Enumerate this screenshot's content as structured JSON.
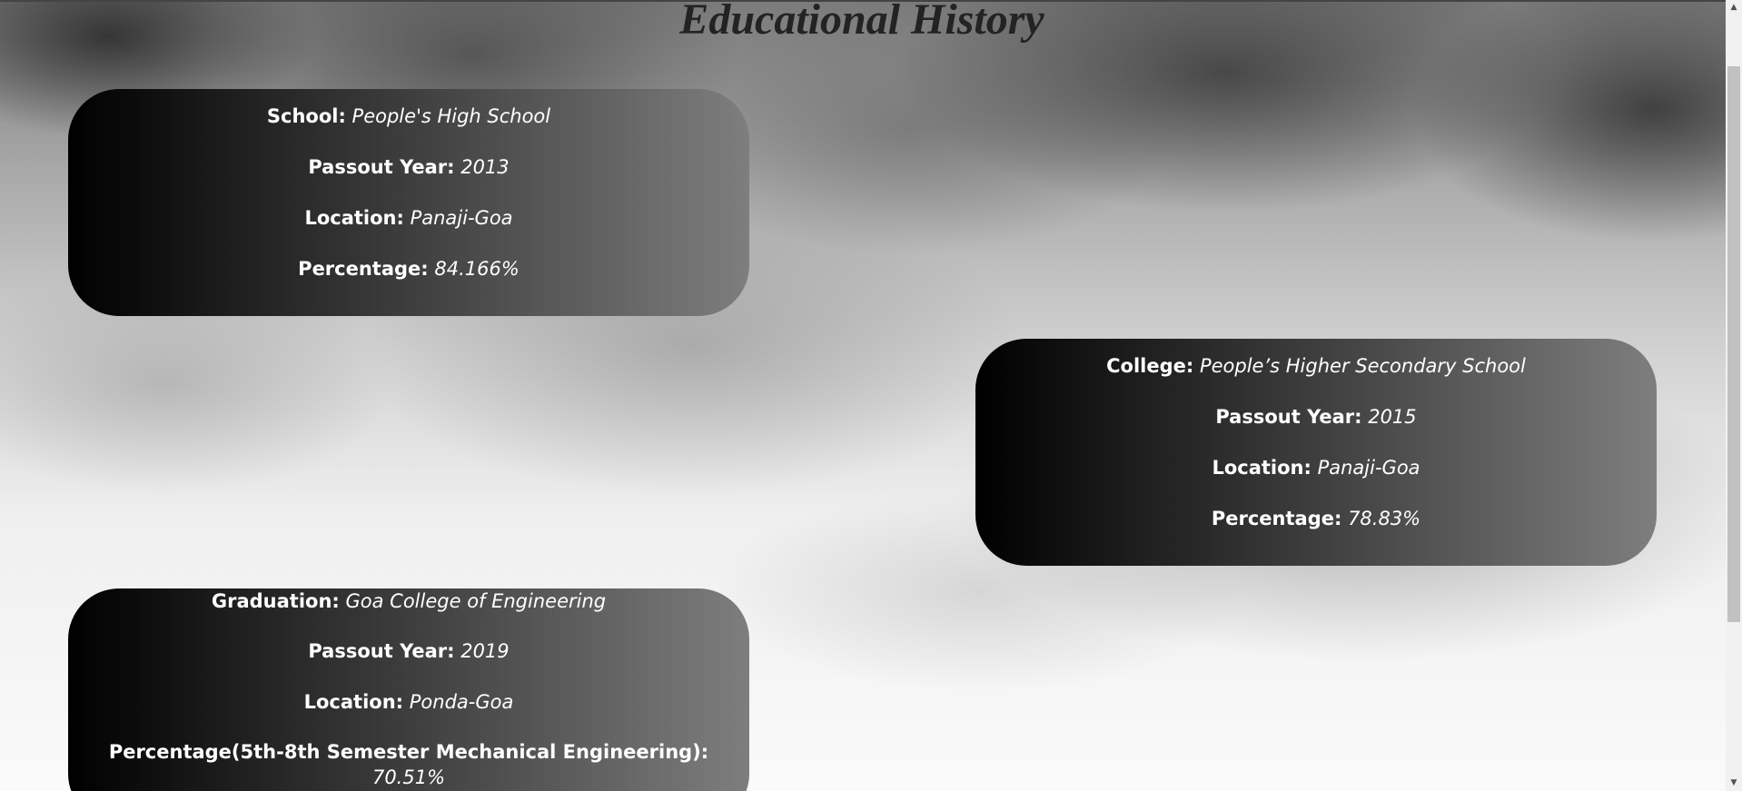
{
  "page": {
    "title": "Educational History"
  },
  "cards": [
    {
      "rows": [
        {
          "label": "School:",
          "value": "People's High School"
        },
        {
          "label": "Passout Year:",
          "value": "2013"
        },
        {
          "label": "Location:",
          "value": "Panaji-Goa"
        },
        {
          "label": "Percentage:",
          "value": "84.166%"
        }
      ]
    },
    {
      "rows": [
        {
          "label": "College:",
          "value": "People’s Higher Secondary School"
        },
        {
          "label": "Passout Year:",
          "value": "2015"
        },
        {
          "label": "Location:",
          "value": "Panaji-Goa"
        },
        {
          "label": "Percentage:",
          "value": "78.83%"
        }
      ]
    },
    {
      "rows": [
        {
          "label": "Graduation:",
          "value": "Goa College of Engineering"
        },
        {
          "label": "Passout Year:",
          "value": "2019"
        },
        {
          "label": "Location:",
          "value": "Ponda-Goa"
        },
        {
          "label": "Percentage(5th-8th Semester Mechanical Engineering):",
          "value": "70.51%"
        }
      ]
    }
  ],
  "scrollbar": {
    "up_arrow": "▲",
    "down_arrow": "▼"
  },
  "colors": {
    "card_gradient_start": "#000000",
    "card_gradient_end": "#7e7e7e",
    "title_color": "#232323",
    "card_text": "#ffffff"
  }
}
